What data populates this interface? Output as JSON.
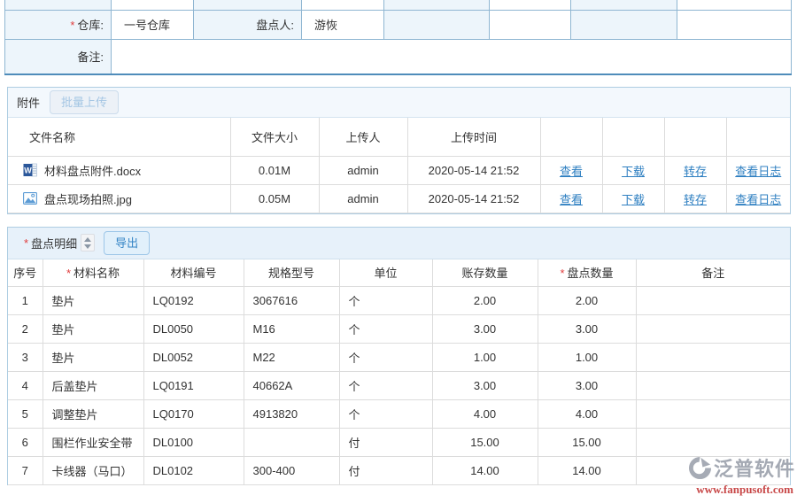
{
  "form": {
    "required_mark": "*",
    "warehouse_label": "仓库:",
    "warehouse_value": "一号仓库",
    "counter_label": "盘点人:",
    "counter_value": "游恢",
    "remark_label": "备注:",
    "remark_value": ""
  },
  "attachments": {
    "title": "附件",
    "batch_upload_label": "批量上传",
    "columns": {
      "name": "文件名称",
      "size": "文件大小",
      "uploader": "上传人",
      "time": "上传时间"
    },
    "actions": {
      "view": "查看",
      "download": "下载",
      "transfer": "转存",
      "log": "查看日志"
    },
    "rows": [
      {
        "icon": "word-file-icon",
        "name": "材料盘点附件.docx",
        "size": "0.01M",
        "uploader": "admin",
        "time": "2020-05-14 21:52"
      },
      {
        "icon": "image-file-icon",
        "name": "盘点现场拍照.jpg",
        "size": "0.05M",
        "uploader": "admin",
        "time": "2020-05-14 21:52"
      }
    ]
  },
  "detail": {
    "title": "盘点明细",
    "export_label": "导出",
    "columns": {
      "no": "序号",
      "name": "材料名称",
      "code": "材料编号",
      "spec": "规格型号",
      "unit": "单位",
      "book_qty": "账存数量",
      "count_qty": "盘点数量",
      "remark": "备注"
    },
    "rows": [
      {
        "no": "1",
        "name": "垫片",
        "code": "LQ0192",
        "spec": "3067616",
        "unit": "个",
        "book_qty": "2.00",
        "count_qty": "2.00",
        "remark": ""
      },
      {
        "no": "2",
        "name": "垫片",
        "code": "DL0050",
        "spec": "M16",
        "unit": "个",
        "book_qty": "3.00",
        "count_qty": "3.00",
        "remark": ""
      },
      {
        "no": "3",
        "name": "垫片",
        "code": "DL0052",
        "spec": "M22",
        "unit": "个",
        "book_qty": "1.00",
        "count_qty": "1.00",
        "remark": ""
      },
      {
        "no": "4",
        "name": "后盖垫片",
        "code": "LQ0191",
        "spec": "40662A",
        "unit": "个",
        "book_qty": "3.00",
        "count_qty": "3.00",
        "remark": ""
      },
      {
        "no": "5",
        "name": "调整垫片",
        "code": "LQ0170",
        "spec": "4913820",
        "unit": "个",
        "book_qty": "4.00",
        "count_qty": "4.00",
        "remark": ""
      },
      {
        "no": "6",
        "name": "围栏作业安全带",
        "code": "DL0100",
        "spec": "",
        "unit": "付",
        "book_qty": "15.00",
        "count_qty": "15.00",
        "remark": ""
      },
      {
        "no": "7",
        "name": "卡线器（马口）",
        "code": "DL0102",
        "spec": "300-400",
        "unit": "付",
        "book_qty": "14.00",
        "count_qty": "14.00",
        "remark": ""
      }
    ]
  },
  "watermark": {
    "brand": "泛普软件",
    "url": "www.fanpusoft.com"
  },
  "colors": {
    "link_blue": "#2e7fc1",
    "form_label_bg": "#edf5fb",
    "form_border": "#8fb6d2",
    "form_bottom_border": "#4f8cba",
    "panel_border": "#aecde2",
    "attach_bar_bg": "#f3f8fd",
    "detail_bar_bg": "#e7f1fa",
    "grid_border": "#dcdcdc",
    "required_red": "#e03c3c",
    "export_btn_text": "#3585c6",
    "watermark_gray": "#989ea9",
    "watermark_red": "#c12f2f"
  }
}
